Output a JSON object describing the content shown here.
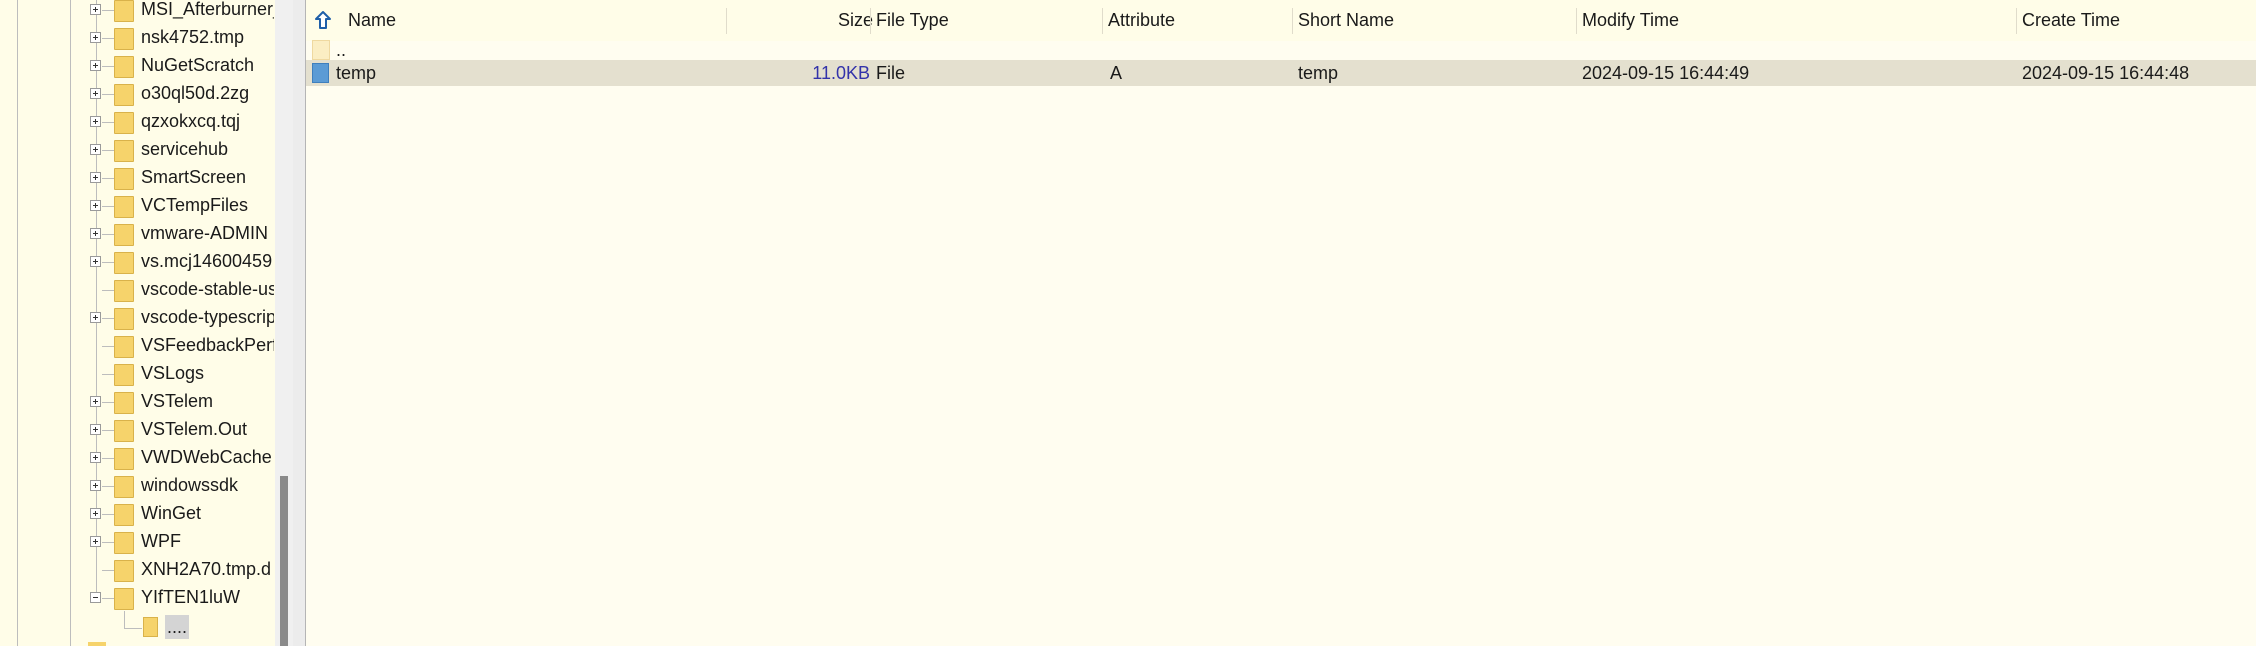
{
  "tree": {
    "items": [
      {
        "label": "MSI_Afterburner_",
        "expander": "plus"
      },
      {
        "label": "nsk4752.tmp",
        "expander": "plus"
      },
      {
        "label": "NuGetScratch",
        "expander": "plus"
      },
      {
        "label": "o30ql50d.2zg",
        "expander": "plus"
      },
      {
        "label": "qzxokxcq.tqj",
        "expander": "plus"
      },
      {
        "label": "servicehub",
        "expander": "plus"
      },
      {
        "label": "SmartScreen",
        "expander": "plus"
      },
      {
        "label": "VCTempFiles",
        "expander": "plus"
      },
      {
        "label": "vmware-ADMIN",
        "expander": "plus"
      },
      {
        "label": "vs.mcj14600459",
        "expander": "plus"
      },
      {
        "label": "vscode-stable-us",
        "expander": "none"
      },
      {
        "label": "vscode-typescrip",
        "expander": "plus"
      },
      {
        "label": "VSFeedbackPerfV",
        "expander": "none"
      },
      {
        "label": "VSLogs",
        "expander": "none"
      },
      {
        "label": "VSTelem",
        "expander": "plus"
      },
      {
        "label": "VSTelem.Out",
        "expander": "plus"
      },
      {
        "label": "VWDWebCache",
        "expander": "plus"
      },
      {
        "label": "windowssdk",
        "expander": "plus"
      },
      {
        "label": "WinGet",
        "expander": "plus"
      },
      {
        "label": "WPF",
        "expander": "plus"
      },
      {
        "label": "XNH2A70.tmp.d",
        "expander": "none"
      },
      {
        "label": "YIfTEN1luW",
        "expander": "minus"
      }
    ],
    "child_label": "...."
  },
  "list": {
    "columns": [
      "Name",
      "Size",
      "File Type",
      "Attribute",
      "Short Name",
      "Modify Time",
      "Create Time"
    ],
    "parent_row": {
      "name": ".."
    },
    "rows": [
      {
        "name": "temp",
        "size": "11.0KB",
        "type": "File",
        "attribute": "A",
        "short_name": "temp",
        "modify_time": "2024-09-15 16:44:49",
        "create_time": "2024-09-15 16:44:48"
      }
    ]
  },
  "colors": {
    "size_text": "#3333aa",
    "selected_row": "#e4e0cf",
    "folder": "#f6d36b",
    "file_icon": "#5b9bd5"
  },
  "icons": [
    "folder-icon",
    "file-icon",
    "up-arrow-icon",
    "expand-plus-icon",
    "collapse-minus-icon"
  ]
}
